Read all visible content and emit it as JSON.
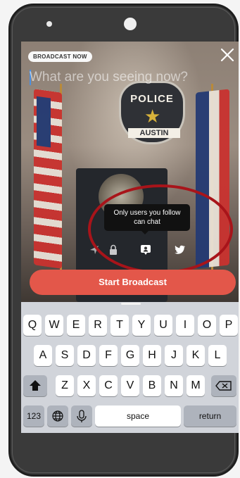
{
  "broadcast_badge": "BROADCAST NOW",
  "prompt_placeholder": "What are you seeing now?",
  "scene": {
    "badge_top": "POLICE",
    "badge_bottom": "AUSTIN"
  },
  "tooltip": {
    "line1": "Only users you follow",
    "line2": "can chat"
  },
  "icons": [
    "location-icon",
    "lock-icon",
    "chat-restricted-icon",
    "twitter-icon",
    "close-icon",
    "shift-icon",
    "backspace-icon",
    "globe-icon",
    "microphone-icon"
  ],
  "start_button": "Start Broadcast",
  "keyboard": {
    "row1": [
      "Q",
      "W",
      "E",
      "R",
      "T",
      "Y",
      "U",
      "I",
      "O",
      "P"
    ],
    "row2": [
      "A",
      "S",
      "D",
      "F",
      "G",
      "H",
      "J",
      "K",
      "L"
    ],
    "row3": [
      "Z",
      "X",
      "C",
      "V",
      "B",
      "N",
      "M"
    ],
    "numbers_key": "123",
    "space_key": "space",
    "return_key": "return"
  },
  "colors": {
    "accent": "#e3574a",
    "annotation": "#a8141a",
    "caret": "#4a90e2"
  }
}
